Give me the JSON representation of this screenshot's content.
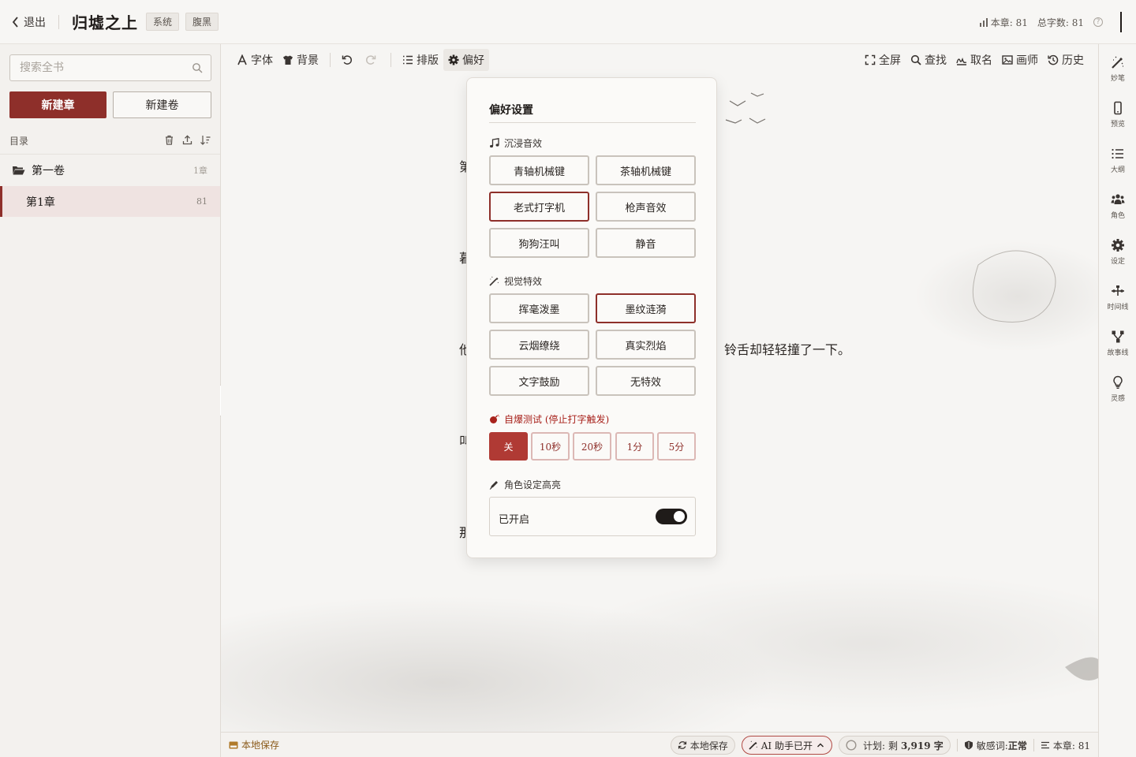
{
  "header": {
    "back_label": "退出",
    "book_title": "归墟之上",
    "tags": [
      "系统",
      "腹黑"
    ],
    "chapter_words": "本章: 81",
    "total_words": "总字数: 81",
    "help": "?"
  },
  "sidebar": {
    "search_placeholder": "搜索全书",
    "new_chapter": "新建章",
    "new_volume": "新建卷",
    "toc_label": "目录",
    "volume": {
      "name": "第一卷",
      "count": "1章"
    },
    "chapter": {
      "name": "第1章",
      "count": "81"
    }
  },
  "toolbar": {
    "font": "字体",
    "background": "背景",
    "layout": "排版",
    "preferences": "偏好",
    "fullscreen": "全屏",
    "find": "查找",
    "naming": "取名",
    "painter": "画师",
    "history": "历史"
  },
  "editor": {
    "line_1": "第",
    "line_2": "暮",
    "line_3a": "他",
    "line_3b": "铃舌却轻轻撞了一下。",
    "line_4": "叫",
    "line_5": "那"
  },
  "popover": {
    "title": "偏好设置",
    "sound": {
      "label": "沉浸音效",
      "options": [
        "青轴机械键",
        "茶轴机械键",
        "老式打字机",
        "枪声音效",
        "狗狗汪叫",
        "静音"
      ],
      "selected": "老式打字机"
    },
    "visual": {
      "label": "视觉特效",
      "options": [
        "挥毫泼墨",
        "墨纹涟漪",
        "云烟缭绕",
        "真实烈焰",
        "文字鼓励",
        "无特效"
      ],
      "selected": "墨纹涟漪"
    },
    "selfdestruct": {
      "label": "自爆测试 (停止打字触发)",
      "options": [
        "关",
        "10秒",
        "20秒",
        "1分",
        "5分"
      ],
      "selected": "关"
    },
    "highlight": {
      "label": "角色设定高亮",
      "status": "已开启",
      "enabled": true
    }
  },
  "rail": {
    "items": [
      "妙笔",
      "预览",
      "大纲",
      "角色",
      "设定",
      "时间线",
      "故事线",
      "灵感"
    ]
  },
  "statusbar": {
    "save_left": "本地保存",
    "save_pill": "本地保存",
    "ai": "AI 助手已开",
    "plan_label": "计划:",
    "plan_value_prefix": "剩",
    "plan_value": "3,919 字",
    "sensitive": "敏感词:",
    "sensitive_value": "正常",
    "chapter": "本章: 81"
  },
  "colors": {
    "accent": "#8e2f2a",
    "danger": "#a8221c",
    "background": "#f4f2ef"
  }
}
